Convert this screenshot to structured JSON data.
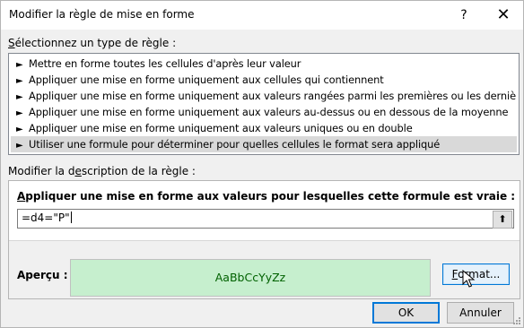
{
  "window": {
    "title": "Modifier la règle de mise en forme",
    "help_glyph": "?",
    "close_glyph": "✕"
  },
  "rule_type": {
    "label_ul": "S",
    "label_rest": "électionnez un type de règle :",
    "arrow_icon": "right-arrow-icon",
    "items": [
      {
        "label": "Mettre en forme toutes les cellules d'après leur valeur"
      },
      {
        "label": "Appliquer une mise en forme uniquement aux cellules qui contiennent"
      },
      {
        "label": "Appliquer une mise en forme uniquement aux valeurs rangées parmi les premières ou les dernières valeurs"
      },
      {
        "label": "Appliquer une mise en forme uniquement aux valeurs au-dessus ou en dessous de la moyenne"
      },
      {
        "label": "Appliquer une mise en forme uniquement aux valeurs uniques ou en double"
      },
      {
        "label": "Utiliser une formule pour déterminer pour quelles cellules le format sera appliqué",
        "selected": true
      }
    ]
  },
  "description": {
    "label_pre": "Modifier la d",
    "label_ul": "e",
    "label_post": "scription de la règle :",
    "formula_label_ul": "A",
    "formula_label_rest": "ppliquer une mise en forme aux valeurs pour lesquelles cette formule est vraie :",
    "formula_value": "=d4=\"P\"",
    "collapse_glyph": "⬆",
    "preview_label": "Aperçu :",
    "preview_sample": "AaBbCcYyZz",
    "preview_fill_color": "#c6efce",
    "preview_font_color": "#006100",
    "format_button_ul": "F",
    "format_button_rest": "ormat..."
  },
  "buttons": {
    "ok": "OK",
    "cancel": "Annuler"
  }
}
